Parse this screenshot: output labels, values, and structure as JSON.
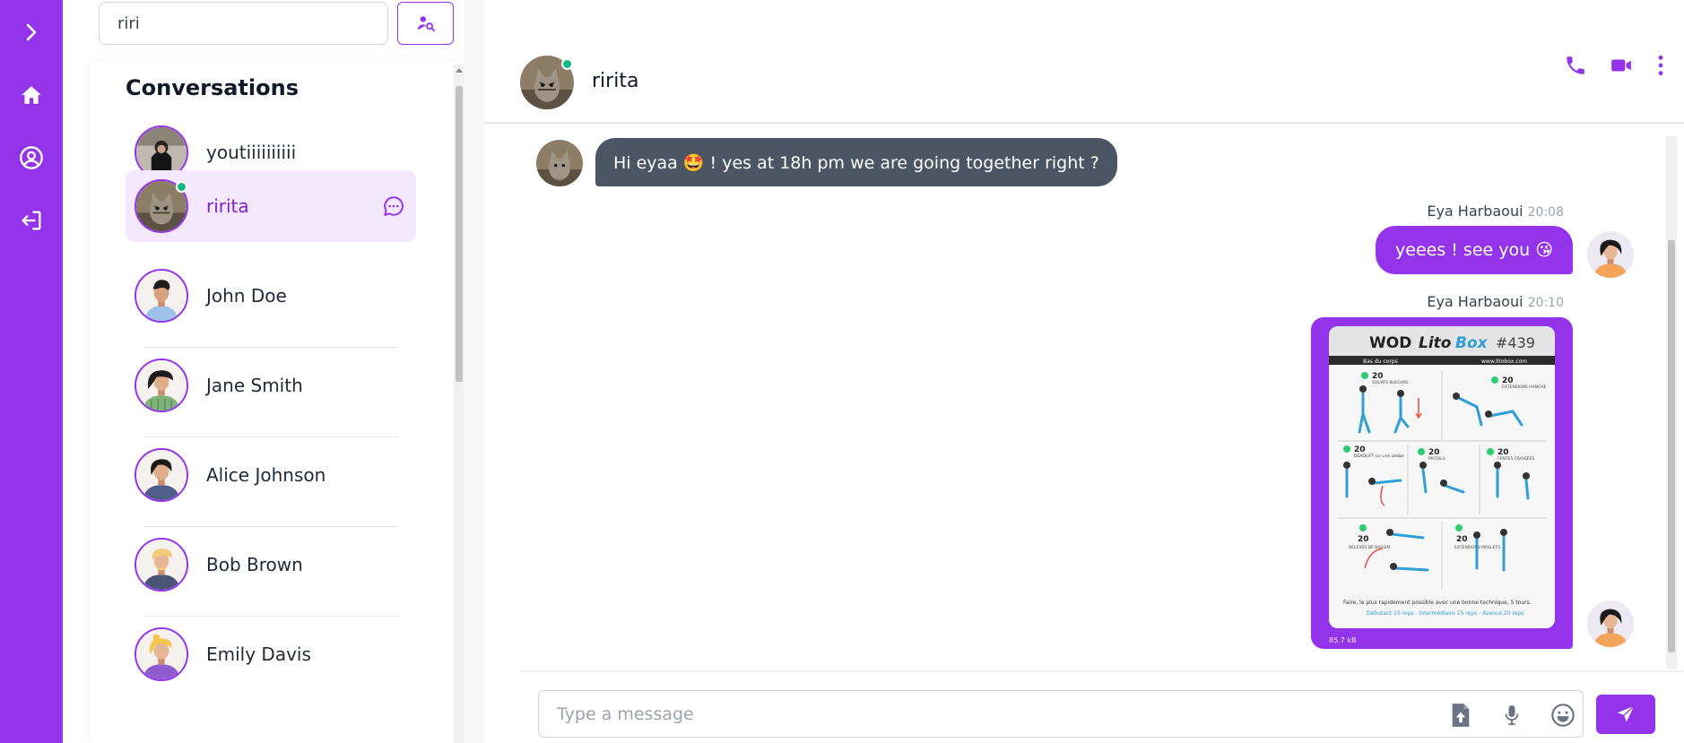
{
  "search": {
    "value": "riri"
  },
  "conversations": {
    "title": "Conversations",
    "items": [
      {
        "name": "youtiiiiiiiiii",
        "active": false,
        "online": false
      },
      {
        "name": "ririta",
        "active": true,
        "online": true
      },
      {
        "name": "John Doe",
        "active": false,
        "online": false
      },
      {
        "name": "Jane Smith",
        "active": false,
        "online": false
      },
      {
        "name": "Alice Johnson",
        "active": false,
        "online": false
      },
      {
        "name": "Bob Brown",
        "active": false,
        "online": false
      },
      {
        "name": "Emily Davis",
        "active": false,
        "online": false
      }
    ]
  },
  "chat": {
    "contact_name": "ririta",
    "messages": [
      {
        "from": "contact",
        "text": "Hi eyaa 🤩 ! yes at 18h pm we are going together right ?"
      },
      {
        "from": "me",
        "sender": "Eya Harbaoui",
        "time": "20:08",
        "text": "yeees ! see you 😘"
      },
      {
        "from": "me",
        "sender": "Eya Harbaoui",
        "time": "20:10",
        "type": "image",
        "image_size": "85.7 kB"
      }
    ],
    "image_card": {
      "title_a": "WOD",
      "title_b": "Lito",
      "title_c": "Box",
      "number": "#439",
      "subtitle": "Bas du corps",
      "site": "www.litobox.com",
      "exercises": [
        {
          "reps": "20",
          "name": "SQUATS BULGARE"
        },
        {
          "reps": "20",
          "name": "EXTENSIONS HANCHE"
        },
        {
          "reps": "20",
          "name": "DEADLIFT sur une jambe"
        },
        {
          "reps": "20",
          "name": "PISTOLS"
        },
        {
          "reps": "20",
          "name": "FENTES CROISÉES"
        },
        {
          "reps": "20",
          "name": "RELEVÉS DE BASSIN"
        },
        {
          "reps": "20",
          "name": "EXTENSIONS MOLLETS"
        }
      ],
      "footer": "Faire, le plus rapidement possible avec une bonne technique, 5 tours.",
      "levels": "Débutant 10 reps - Intermédiaire 15 reps - Avancé 20 reps"
    },
    "input_placeholder": "Type a message"
  },
  "colors": {
    "accent": "#9333ea",
    "accent_light": "#f3e8ff",
    "bubble_contact": "#4b5563",
    "online": "#10b981"
  },
  "icons": {
    "rail": [
      "chevron-right-icon",
      "home-icon",
      "user-circle-icon",
      "logout-icon"
    ],
    "header": [
      "phone-icon",
      "video-icon",
      "more-vertical-icon"
    ],
    "input": [
      "file-upload-icon",
      "microphone-icon",
      "emoji-icon"
    ],
    "send": "send-icon"
  }
}
